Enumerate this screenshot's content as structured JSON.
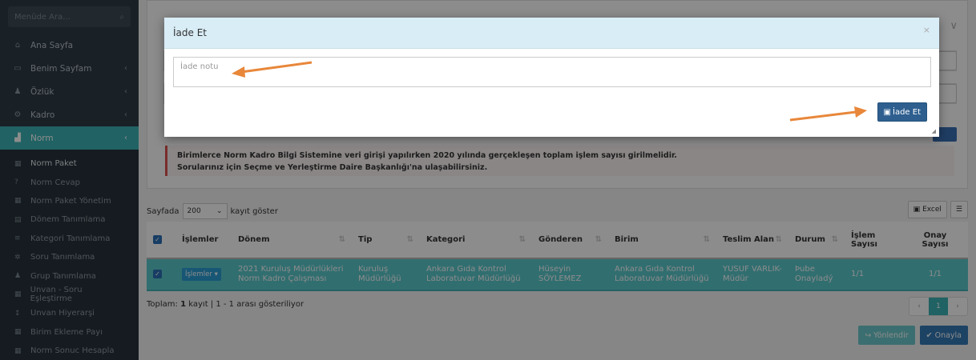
{
  "sidebar": {
    "search_placeholder": "Menüde Ara...",
    "items": [
      {
        "label": "Ana Sayfa",
        "icon": "home-icon"
      },
      {
        "label": "Benim Sayfam",
        "icon": "window-icon"
      },
      {
        "label": "Özlük",
        "icon": "users-icon"
      },
      {
        "label": "Kadro",
        "icon": "sitemap-icon"
      },
      {
        "label": "Norm",
        "icon": "chart-icon"
      }
    ],
    "subitems": [
      "Norm Paket",
      "Norm Cevap",
      "Norm Paket Yönetim",
      "Dönem Tanımlama",
      "Kategori Tanımlama",
      "Soru Tanımlama",
      "Grup Tanımlama",
      "Unvan - Soru Eşleştirme",
      "Unvan Hiyerarşi",
      "Birim Ekleme Payı",
      "Norm Sonuc Hesapla"
    ]
  },
  "alert": {
    "line1": "Birimlerce Norm Kadro Bilgi Sistemine veri girişi yapılırken 2020 yılında gerçekleşen toplam işlem sayısı girilmelidir.",
    "line2": "Sorularınız için Seçme ve Yerleştirme Daire Başkanlığı'na ulaşabilirsiniz."
  },
  "table": {
    "length_prefix": "Sayfada",
    "length_value": "200",
    "length_suffix": "kayıt göster",
    "excel_label": "Excel",
    "headers": [
      "İşlemler",
      "Dönem",
      "Tip",
      "Kategori",
      "Gönderen",
      "Birim",
      "Teslim Alan",
      "Durum",
      "İşlem Sayısı",
      "Onay Sayısı"
    ],
    "rows": [
      {
        "islem_btn": "İşlemler",
        "donem": "2021 Kuruluş Müdürlükleri Norm Kadro Çalışması",
        "tip": "Kuruluş Müdürlüğü",
        "kategori": "Ankara Gıda Kontrol Laboratuvar Müdürlüğü",
        "gonderen": "Hüseyin SÖYLEMEZ",
        "birim": "Ankara Gıda Kontrol Laboratuvar Müdürlüğü",
        "teslim_alan": "YUSUF VARLIK-Müdür",
        "durum": "Þube Onayladý",
        "islem_sayisi": "1/1",
        "onay_sayisi": "1/1"
      }
    ],
    "info_prefix": "Toplam:",
    "info_count": "1",
    "info_suffix": "kayıt | 1 - 1 arası gösteriliyor",
    "pager": [
      "‹",
      "1",
      "›"
    ],
    "yonlendir_label": "Yönlendir",
    "onayla_label": "Onayla"
  },
  "modal": {
    "title": "İade Et",
    "close_glyph": "×",
    "note_placeholder": "İade notu",
    "submit_label": "İade Et"
  },
  "colors": {
    "accent": "#3cb3b6",
    "arrow": "#e8873a",
    "modal_header": "#d9edf7"
  }
}
